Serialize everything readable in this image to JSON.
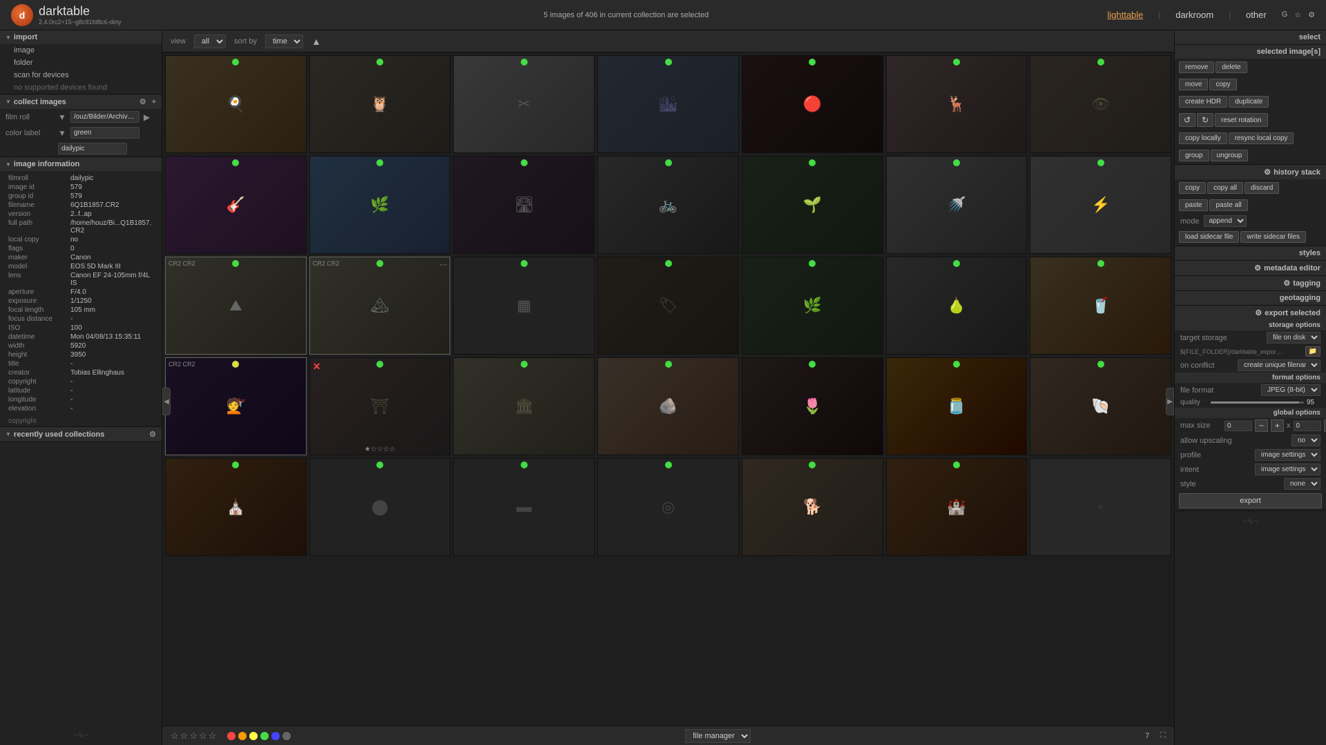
{
  "app": {
    "name": "darktable",
    "version": "2.4.0rc2+15~g8c81fd8c6-dirty",
    "logo_letter": "d"
  },
  "header": {
    "selection_status": "5 images of 406 in current collection are selected",
    "view_modes": [
      "lighttable",
      "darkroom",
      "other"
    ],
    "active_mode": "lighttable",
    "icons": [
      "G",
      "☆",
      "⚙"
    ]
  },
  "toolbar": {
    "view_label": "view",
    "view_value": "all",
    "sort_label": "sort by",
    "sort_value": "time"
  },
  "left_sidebar": {
    "import_section": "import",
    "import_items": [
      "image",
      "folder",
      "scan for devices",
      "no supported devices found"
    ],
    "collect_section": "collect images",
    "collect_rows": [
      {
        "label": "film roll",
        "value": "/ouz/Bilder/Archiv/dailypic"
      },
      {
        "label": "color label",
        "value": "green"
      },
      {
        "label": "",
        "value": "dailypic"
      }
    ],
    "recently_section": "recently used collections",
    "image_info_section": "image information",
    "image_info": {
      "filmroll": "dailypic",
      "image_id": "579",
      "group_id": "579",
      "filename": "6Q1B1857.CR2",
      "version": "2..f..ap",
      "full_path": "/home/houz/Bi...Q1B1857.CR2",
      "local_copy": "no",
      "flags": "0",
      "maker": "Canon",
      "model": "EOS 5D Mark III",
      "lens": "Canon EF 24-105mm f/4L IS",
      "aperture": "F/4.0",
      "exposure": "1/1250",
      "focal_length": "105 mm",
      "focus_distance": "-",
      "iso": "100",
      "datetime": "Mon 04/08/13 15:35:11",
      "width": "5920",
      "height": "3950",
      "title": "-",
      "creator": "Tobias Ellinghaus",
      "copyright": "-",
      "latitude": "-",
      "longitude": "-",
      "elevation": "-"
    },
    "copyright_text": "copyright"
  },
  "right_sidebar": {
    "select_label": "select",
    "selected_images_label": "selected image[s]",
    "buttons": {
      "remove": "remove",
      "delete": "delete",
      "move": "move",
      "copy": "copy",
      "create_hdr": "create HDR",
      "duplicate": "duplicate",
      "rotate_ccw": "↺",
      "rotate_cw": "↻",
      "reset_rotation": "reset rotation",
      "copy_locally": "copy locally",
      "resync_local_copy": "resync local copy",
      "group": "group",
      "ungroup": "ungroup"
    },
    "history_stack_label": "history stack",
    "history_buttons": {
      "copy": "copy",
      "copy_all": "copy all",
      "discard": "discard",
      "paste": "paste",
      "paste_all": "paste all"
    },
    "mode_label": "mode",
    "mode_value": "append",
    "load_sidecar": "load sidecar file",
    "write_sidecar": "write sidecar files",
    "styles_label": "styles",
    "metadata_editor_label": "metadata editor",
    "tagging_label": "tagging",
    "geotagging_label": "geotagging",
    "export_label": "export selected",
    "storage_options_label": "storage options",
    "target_storage_label": "target storage",
    "target_storage_value": "file on disk",
    "path_value": "${FILE_FOLDER}/darktable_exported/img...",
    "on_conflict_label": "on conflict",
    "on_conflict_value": "create unique filename",
    "format_options_label": "format options",
    "file_format_label": "file format",
    "file_format_value": "JPEG (8-bit)",
    "quality_label": "quality",
    "quality_value": "95",
    "global_options_label": "global options",
    "max_size_label": "max size",
    "max_size_w": "0",
    "max_size_h": "0",
    "allow_upscaling_label": "allow upscaling",
    "allow_upscaling_value": "no",
    "profile_label": "profile",
    "profile_value": "image settings",
    "intent_label": "intent",
    "intent_value": "image settings",
    "style_label": "style",
    "style_value": "none",
    "export_button": "export"
  },
  "bottom_bar": {
    "view_label": "file manager",
    "page_number": "7",
    "star_labels": [
      "☆",
      "☆",
      "☆",
      "☆",
      "☆"
    ],
    "color_dots": [
      "#f00",
      "#f90",
      "#ff0",
      "#0d0",
      "#00f",
      "#888"
    ]
  },
  "photos": [
    {
      "id": 1,
      "class": "ph-egg",
      "dot": "green",
      "stars": ""
    },
    {
      "id": 2,
      "class": "ph-owl",
      "dot": "green",
      "stars": ""
    },
    {
      "id": 3,
      "class": "ph-needle",
      "dot": "green",
      "stars": ""
    },
    {
      "id": 4,
      "class": "ph-building",
      "dot": "green",
      "stars": ""
    },
    {
      "id": 5,
      "class": "ph-dark",
      "dot": "green",
      "stars": ""
    },
    {
      "id": 6,
      "class": "ph-deer",
      "dot": "green",
      "stars": ""
    },
    {
      "id": 7,
      "class": "ph-deer2",
      "dot": "green",
      "stars": ""
    },
    {
      "id": 8,
      "class": "ph-picks",
      "dot": "green",
      "stars": ""
    },
    {
      "id": 9,
      "class": "ph-catkins",
      "dot": "green",
      "stars": ""
    },
    {
      "id": 10,
      "class": "ph-road",
      "dot": "green",
      "stars": ""
    },
    {
      "id": 11,
      "class": "ph-bike",
      "dot": "green",
      "stars": ""
    },
    {
      "id": 12,
      "class": "ph-plant",
      "dot": "green",
      "stars": ""
    },
    {
      "id": 13,
      "class": "ph-sink",
      "dot": "green",
      "stars": ""
    },
    {
      "id": 14,
      "class": "ph-crack",
      "dot": "green",
      "stars": ""
    },
    {
      "id": 15,
      "class": "ph-stone",
      "dot": "green",
      "cr2": true,
      "stars": ""
    },
    {
      "id": 16,
      "class": "ph-hair",
      "dot": "yellow",
      "cr2": true,
      "stars": ""
    },
    {
      "id": 17,
      "class": "ph-clock",
      "dot": "green",
      "stars": ""
    },
    {
      "id": 18,
      "class": "ph-arch",
      "dot": "green",
      "stars": ""
    },
    {
      "id": 19,
      "class": "ph-city",
      "dot": "green",
      "stars": ""
    },
    {
      "id": 20,
      "class": "ph-sign",
      "dot": "green",
      "stars": ""
    },
    {
      "id": 21,
      "class": "ph-fern",
      "dot": "green",
      "stars": ""
    },
    {
      "id": 22,
      "class": "ph-pear",
      "dot": "green",
      "stars": ""
    },
    {
      "id": 23,
      "class": "ph-drinks",
      "dot": "green",
      "stars": ""
    },
    {
      "id": 24,
      "class": "ph-arch2",
      "dot": "green",
      "stars": "☆☆☆☆☆",
      "reject": true
    },
    {
      "id": 25,
      "class": "ph-ruins",
      "dot": "green",
      "stars": ""
    },
    {
      "id": 26,
      "class": "ph-stone2",
      "dot": "green",
      "stars": ""
    },
    {
      "id": 27,
      "class": "ph-tulip",
      "dot": "green",
      "stars": ""
    },
    {
      "id": 28,
      "class": "ph-jar",
      "dot": "green",
      "stars": ""
    },
    {
      "id": 29,
      "class": "ph-shell",
      "dot": "green",
      "stars": ""
    },
    {
      "id": 30,
      "class": "ph-church",
      "dot": "green",
      "stars": ""
    },
    {
      "id": 31,
      "class": "ph-dog",
      "dot": "green",
      "stars": ""
    },
    {
      "id": 32,
      "class": "ph-bw",
      "dot": "green",
      "stars": ""
    }
  ]
}
